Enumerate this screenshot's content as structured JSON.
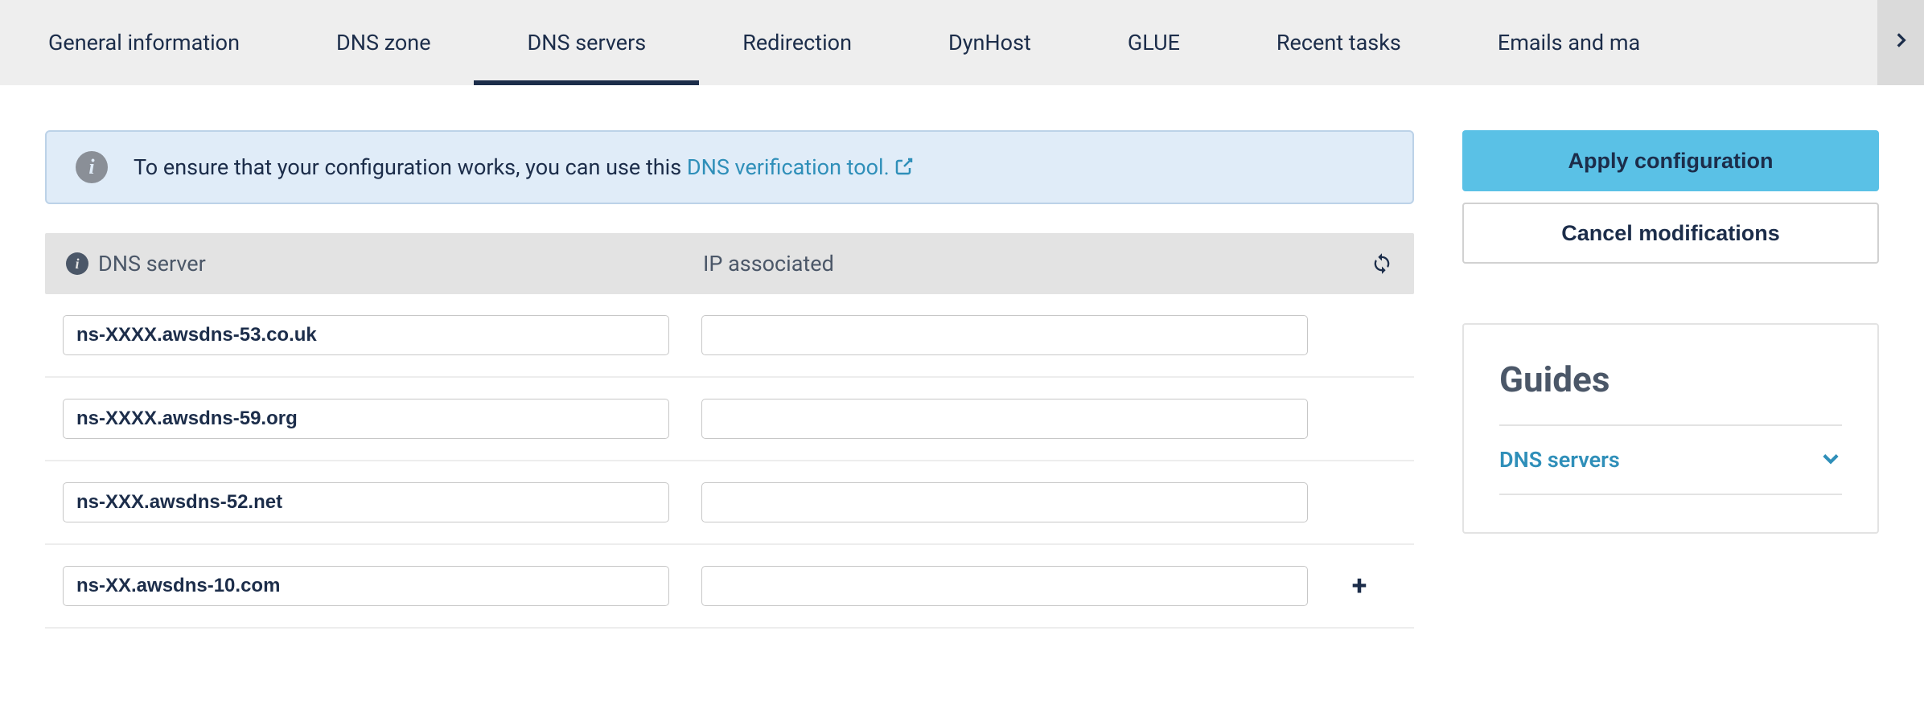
{
  "tabs": [
    {
      "label": "General information",
      "active": false
    },
    {
      "label": "DNS zone",
      "active": false
    },
    {
      "label": "DNS servers",
      "active": true
    },
    {
      "label": "Redirection",
      "active": false
    },
    {
      "label": "DynHost",
      "active": false
    },
    {
      "label": "GLUE",
      "active": false
    },
    {
      "label": "Recent tasks",
      "active": false
    },
    {
      "label": "Emails and ma",
      "active": false
    }
  ],
  "banner": {
    "text_prefix": "To ensure that your configuration works, you can use this ",
    "link_text": "DNS verification tool."
  },
  "table": {
    "header_dns": "DNS server",
    "header_ip": "IP associated"
  },
  "rows": [
    {
      "server": "ns-XXXX.awsdns-53.co.uk",
      "ip": "",
      "add": false
    },
    {
      "server": "ns-XXXX.awsdns-59.org",
      "ip": "",
      "add": false
    },
    {
      "server": "ns-XXX.awsdns-52.net",
      "ip": "",
      "add": false
    },
    {
      "server": "ns-XX.awsdns-10.com",
      "ip": "",
      "add": true
    }
  ],
  "actions": {
    "apply": "Apply configuration",
    "cancel": "Cancel modifications"
  },
  "guides": {
    "title": "Guides",
    "item": "DNS servers"
  },
  "colors": {
    "accent_blue": "#5ac1e6",
    "link_blue": "#2f8fb9",
    "text_dark": "#1c2d4a",
    "banner_bg": "#e0ecf8"
  }
}
